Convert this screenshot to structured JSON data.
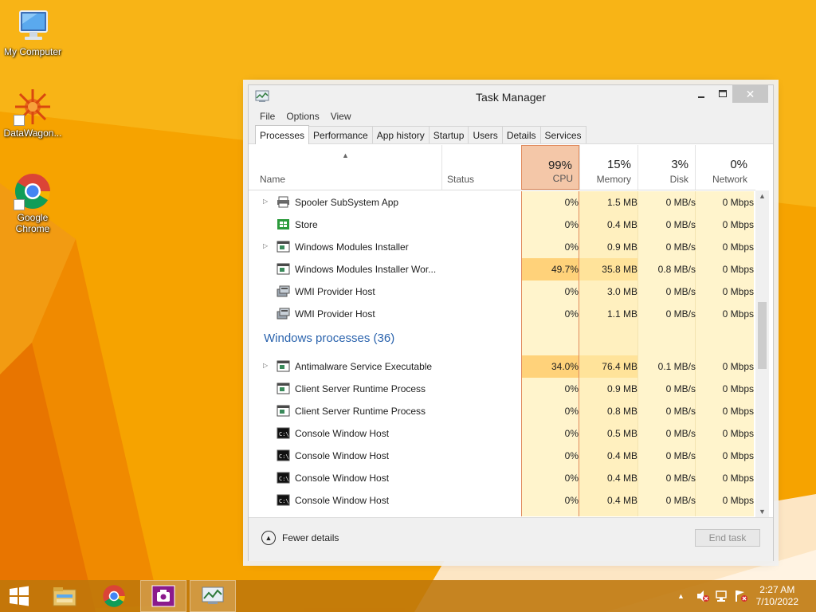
{
  "desktop": {
    "icons": [
      {
        "label": "My Computer",
        "icon": "computer-icon"
      },
      {
        "label": "DataWagon...",
        "icon": "datawagon-icon"
      },
      {
        "label": "Google Chrome",
        "icon": "chrome-icon"
      }
    ]
  },
  "window": {
    "title": "Task Manager",
    "menu": [
      "File",
      "Options",
      "View"
    ],
    "tabs": [
      "Processes",
      "Performance",
      "App history",
      "Startup",
      "Users",
      "Details",
      "Services"
    ],
    "active_tab": "Processes",
    "columns": {
      "name": "Name",
      "status": "Status",
      "cpu": {
        "pct": "99%",
        "label": "CPU"
      },
      "memory": {
        "pct": "15%",
        "label": "Memory"
      },
      "disk": {
        "pct": "3%",
        "label": "Disk"
      },
      "network": {
        "pct": "0%",
        "label": "Network"
      }
    },
    "rows_top": [
      {
        "name": "Spooler SubSystem App",
        "expandable": true,
        "icon": "printer-icon",
        "cpu": "0%",
        "memory": "1.5 MB",
        "disk": "0 MB/s",
        "network": "0 Mbps"
      },
      {
        "name": "Store",
        "expandable": false,
        "icon": "store-icon",
        "cpu": "0%",
        "memory": "0.4 MB",
        "disk": "0 MB/s",
        "network": "0 Mbps"
      },
      {
        "name": "Windows Modules Installer",
        "expandable": true,
        "icon": "app-window-icon",
        "cpu": "0%",
        "memory": "0.9 MB",
        "disk": "0 MB/s",
        "network": "0 Mbps"
      },
      {
        "name": "Windows Modules Installer Wor...",
        "expandable": false,
        "icon": "app-window-icon",
        "cpu": "49.7%",
        "memory": "35.8 MB",
        "disk": "0.8 MB/s",
        "network": "0 Mbps"
      },
      {
        "name": "WMI Provider Host",
        "expandable": false,
        "icon": "wmi-icon",
        "cpu": "0%",
        "memory": "3.0 MB",
        "disk": "0 MB/s",
        "network": "0 Mbps"
      },
      {
        "name": "WMI Provider Host",
        "expandable": false,
        "icon": "wmi-icon",
        "cpu": "0%",
        "memory": "1.1 MB",
        "disk": "0 MB/s",
        "network": "0 Mbps"
      }
    ],
    "group_title": "Windows processes (36)",
    "rows_bottom": [
      {
        "name": "Antimalware Service Executable",
        "expandable": true,
        "icon": "app-window-icon",
        "cpu": "34.0%",
        "memory": "76.4 MB",
        "disk": "0.1 MB/s",
        "network": "0 Mbps"
      },
      {
        "name": "Client Server Runtime Process",
        "expandable": false,
        "icon": "app-window-icon",
        "cpu": "0%",
        "memory": "0.9 MB",
        "disk": "0 MB/s",
        "network": "0 Mbps"
      },
      {
        "name": "Client Server Runtime Process",
        "expandable": false,
        "icon": "app-window-icon",
        "cpu": "0%",
        "memory": "0.8 MB",
        "disk": "0 MB/s",
        "network": "0 Mbps"
      },
      {
        "name": "Console Window Host",
        "expandable": false,
        "icon": "console-icon",
        "cpu": "0%",
        "memory": "0.5 MB",
        "disk": "0 MB/s",
        "network": "0 Mbps"
      },
      {
        "name": "Console Window Host",
        "expandable": false,
        "icon": "console-icon",
        "cpu": "0%",
        "memory": "0.4 MB",
        "disk": "0 MB/s",
        "network": "0 Mbps"
      },
      {
        "name": "Console Window Host",
        "expandable": false,
        "icon": "console-icon",
        "cpu": "0%",
        "memory": "0.4 MB",
        "disk": "0 MB/s",
        "network": "0 Mbps"
      },
      {
        "name": "Console Window Host",
        "expandable": false,
        "icon": "console-icon",
        "cpu": "0%",
        "memory": "0.4 MB",
        "disk": "0 MB/s",
        "network": "0 Mbps"
      }
    ],
    "footer": {
      "fewer_details": "Fewer details",
      "end_task": "End task"
    }
  },
  "taskbar": {
    "items": [
      "start-button",
      "file-explorer-icon",
      "chrome-icon",
      "camera-app-icon",
      "task-manager-icon"
    ],
    "clock": {
      "time": "2:27 AM",
      "date": "7/10/2022"
    }
  },
  "colors": {
    "wallpaper": "#f6a300",
    "cpu_header": "#f4c7a8",
    "cpu_cell_light": "#fff4cc",
    "cpu_cell_high": "#ffd27a",
    "group_title": "#2a63ad"
  }
}
